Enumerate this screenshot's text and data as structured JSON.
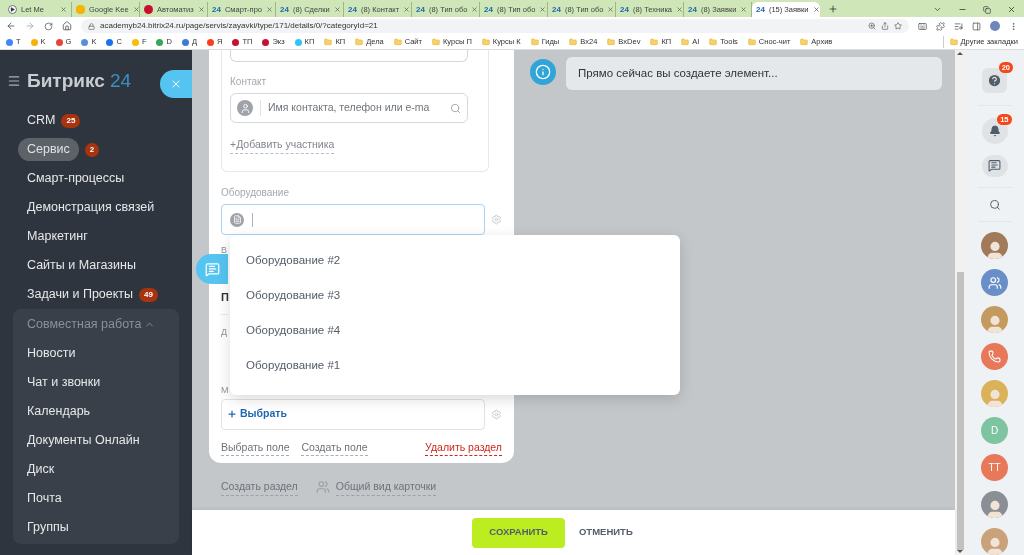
{
  "browser": {
    "tabs": [
      {
        "title": "Let Me",
        "icon": {
          "kind": "play"
        },
        "selected": false
      },
      {
        "title": "Google Kee",
        "icon": {
          "kind": "square",
          "color": "#f6b400"
        },
        "selected": false
      },
      {
        "title": "Автоматиз",
        "icon": {
          "kind": "dot",
          "color": "#c8102e"
        },
        "selected": false
      },
      {
        "title": "Смарт-про",
        "icon": {
          "kind": "text",
          "text": "24"
        },
        "selected": false
      },
      {
        "title": "(8) Сделки",
        "icon": {
          "kind": "text",
          "text": "24"
        },
        "selected": false
      },
      {
        "title": "(8) Контакт",
        "icon": {
          "kind": "text",
          "text": "24"
        },
        "selected": false
      },
      {
        "title": "(8) Тип обо",
        "icon": {
          "kind": "text",
          "text": "24"
        },
        "selected": false
      },
      {
        "title": "(8) Тип обо",
        "icon": {
          "kind": "text",
          "text": "24"
        },
        "selected": false
      },
      {
        "title": "(8) Тип обо",
        "icon": {
          "kind": "text",
          "text": "24"
        },
        "selected": false
      },
      {
        "title": "(8) Техника",
        "icon": {
          "kind": "text",
          "text": "24"
        },
        "selected": false
      },
      {
        "title": "(8) Заявки",
        "icon": {
          "kind": "text",
          "text": "24"
        },
        "selected": false
      },
      {
        "title": "(15) Заявки",
        "icon": {
          "kind": "text",
          "text": "24"
        },
        "selected": true
      }
    ],
    "url": "academyb24.bitrix24.ru/page/servis/zayavki/type/171/details/0/?categoryId=21",
    "bookmarks": [
      {
        "label": "T",
        "kind": "site",
        "color": "#4285f4"
      },
      {
        "label": "K",
        "kind": "site",
        "color": "#f6b400"
      },
      {
        "label": "G",
        "kind": "site",
        "color": "#ea4335"
      },
      {
        "label": "K",
        "kind": "site",
        "color": "#5b8dd6"
      },
      {
        "label": "C",
        "kind": "site",
        "color": "#1a73e8"
      },
      {
        "label": "F",
        "kind": "site",
        "color": "#fbbc04"
      },
      {
        "label": "D",
        "kind": "site",
        "color": "#34a853"
      },
      {
        "label": "Д",
        "kind": "site",
        "color": "#3d7bd9"
      },
      {
        "label": "Я",
        "kind": "site",
        "color": "#fc3f1d"
      },
      {
        "label": "ТП",
        "kind": "site",
        "color": "#c8102e"
      },
      {
        "label": "Экз",
        "kind": "site",
        "color": "#c8102e"
      },
      {
        "label": "КП",
        "kind": "site",
        "color": "#2fc6f6"
      },
      {
        "label": "КП",
        "kind": "folder"
      },
      {
        "label": "Дела",
        "kind": "folder"
      },
      {
        "label": "Сайт",
        "kind": "folder"
      },
      {
        "label": "Курсы П",
        "kind": "folder"
      },
      {
        "label": "Курсы К",
        "kind": "folder"
      },
      {
        "label": "Гиды",
        "kind": "folder"
      },
      {
        "label": "Bx24",
        "kind": "folder"
      },
      {
        "label": "BxDev",
        "kind": "folder"
      },
      {
        "label": "КП",
        "kind": "folder"
      },
      {
        "label": "AI",
        "kind": "folder"
      },
      {
        "label": "Tools",
        "kind": "folder"
      },
      {
        "label": "Снос-чит",
        "kind": "folder"
      },
      {
        "label": "Архив",
        "kind": "folder"
      }
    ],
    "other_bookmarks": "Другие закладки"
  },
  "sidebar": {
    "logo": {
      "name": "Битрикс",
      "number": "24"
    },
    "items": [
      {
        "label": "CRM",
        "badge": "25",
        "selected": false
      },
      {
        "label": "Сервис",
        "badge": "2",
        "selected": true
      },
      {
        "label": "Смарт-процессы",
        "selected": false
      },
      {
        "label": "Демонстрация связей",
        "selected": false
      },
      {
        "label": "Маркетинг",
        "selected": false
      },
      {
        "label": "Сайты и Магазины",
        "selected": false
      },
      {
        "label": "Задачи и Проекты",
        "badge": "49",
        "selected": false
      },
      {
        "label": "Совместная работа",
        "selected": false,
        "expanded": true,
        "children": [
          {
            "label": "Новости",
            "selected": false
          },
          {
            "label": "Чат и звонки",
            "selected": false
          },
          {
            "label": "Календарь",
            "selected": false
          },
          {
            "label": "Документы Онлайн",
            "selected": false
          },
          {
            "label": "Диск",
            "selected": false
          },
          {
            "label": "Почта",
            "selected": false
          },
          {
            "label": "Группы",
            "selected": false
          }
        ]
      }
    ]
  },
  "form": {
    "contact": {
      "label": "Контакт",
      "placeholder": "Имя контакта, телефон или e-ma"
    },
    "add_participant": "+Добавить участника",
    "equipment": {
      "label": "Оборудование",
      "focused": true
    },
    "partial_rows": [
      {
        "kind": "label",
        "text": "В"
      },
      {
        "kind": "title",
        "text": "П"
      },
      {
        "kind": "label",
        "text": "Д"
      },
      {
        "kind": "label",
        "text": "М"
      }
    ],
    "choose_button": "Выбрать",
    "links": [
      {
        "text": "Выбрать поле",
        "kind": "normal"
      },
      {
        "text": "Создать поле",
        "kind": "normal"
      },
      {
        "text": "Удалить раздел",
        "kind": "danger"
      }
    ]
  },
  "card_actions": [
    {
      "text": "Создать раздел",
      "kind": "plain"
    },
    {
      "text": "Общий вид карточки",
      "kind": "with_icon"
    }
  ],
  "dropdown": {
    "options": [
      "Оборудование #2",
      "Оборудование #3",
      "Оборудование #4",
      "Оборудование #1"
    ]
  },
  "info_message": "Прямо сейчас вы создаете элемент...",
  "footer": {
    "save": "СОХРАНИТЬ",
    "cancel": "ОТМЕНИТЬ"
  },
  "right_panel": {
    "help_badge": "20",
    "notifications_badge": "15",
    "contacts": [
      {
        "kind": "photo",
        "color": "#a07a5a"
      },
      {
        "kind": "group",
        "color": "#6a8fc8"
      },
      {
        "kind": "photo",
        "color": "#c49a5e"
      },
      {
        "kind": "call",
        "color": "#e8785a"
      },
      {
        "kind": "photo",
        "color": "#d9b25a"
      },
      {
        "kind": "initials",
        "text": "D",
        "color": "#7ec4a0"
      },
      {
        "kind": "initials",
        "text": "TT",
        "color": "#e8785a"
      },
      {
        "kind": "photo",
        "color": "#8a8f96"
      },
      {
        "kind": "photo",
        "color": "#c9a27c"
      }
    ]
  }
}
